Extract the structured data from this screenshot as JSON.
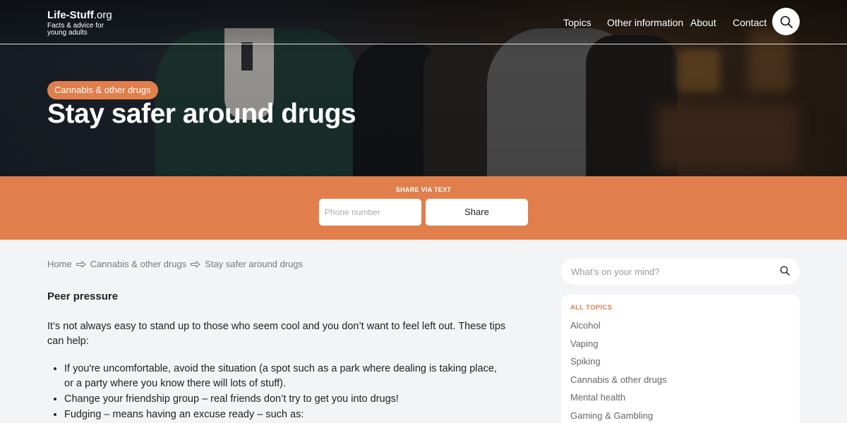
{
  "brand": {
    "name": "Life-Stuff",
    "tld": ".org",
    "tagline": "Facts & advice for young adults"
  },
  "nav": {
    "topics": "Topics",
    "other": "Other information",
    "about": "About",
    "contact": "Contact"
  },
  "hero": {
    "category": "Cannabis & other drugs",
    "title": "Stay safer around drugs"
  },
  "share": {
    "label": "SHARE VIA TEXT",
    "phone_placeholder": "Phone number",
    "button": "Share"
  },
  "breadcrumb": {
    "home": "Home",
    "category": "Cannabis & other drugs",
    "current": "Stay safer around drugs"
  },
  "article": {
    "heading": "Peer pressure",
    "intro": "It’s not always easy to stand up to those who seem cool and you don’t want to feel left out. These tips can help:",
    "tips": [
      "If you're uncomfortable, avoid the situation (a spot such as a park where dealing is taking place, or a party where you know there will lots of stuff).",
      "Change your friendship group – real friends don’t try to get you into drugs!",
      "Fudging – means having an excuse ready – such as:"
    ]
  },
  "sidebar": {
    "search_placeholder": "What’s on your mind?",
    "topics_heading": "ALL TOPICS",
    "topics": [
      "Alcohol",
      "Vaping",
      "Spiking",
      "Cannabis & other drugs",
      "Mental health",
      "Gaming & Gambling"
    ]
  },
  "colors": {
    "accent": "#e07f4c",
    "page_bg": "#f3f4f6"
  },
  "icons": {
    "search": "search-icon",
    "arrow": "right-arrow-icon"
  }
}
